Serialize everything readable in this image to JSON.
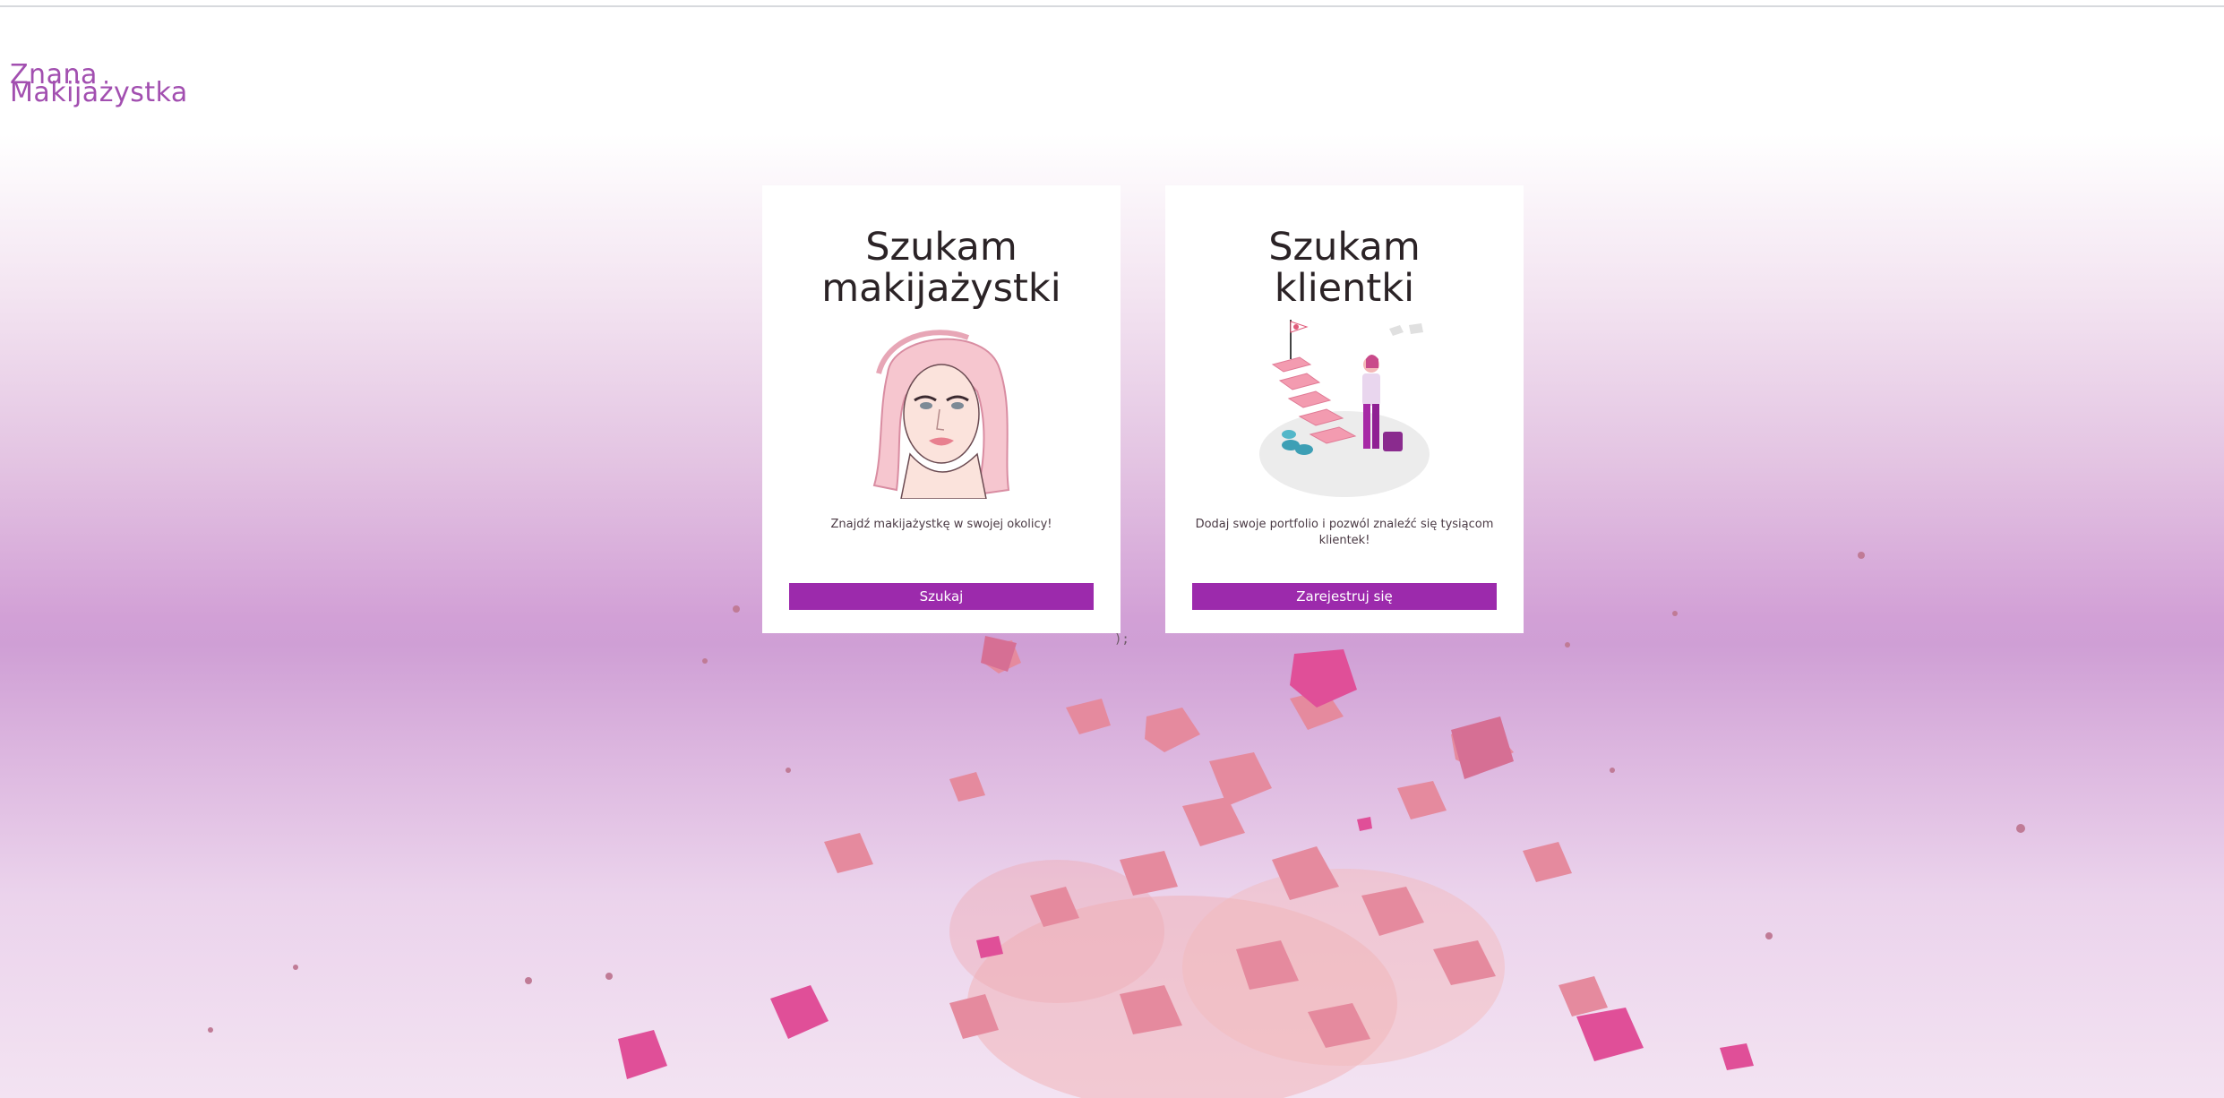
{
  "site": {
    "logo_line1": "Znana",
    "logo_line2": "Makijażystka"
  },
  "cards": [
    {
      "title_line1": "Szukam",
      "title_line2": "makijażystki",
      "description": "Znajdź makijażystkę w swojej okolicy!",
      "button_label": "Szukaj",
      "illustration": "woman-face-illustration"
    },
    {
      "title_line1": "Szukam",
      "title_line2": "klientki",
      "description": "Dodaj swoje portfolio i pozwól znaleźć się tysiącom klientek!",
      "button_label": "Zarejestruj się",
      "illustration": "career-stairs-illustration"
    }
  ],
  "stray_mark": ");",
  "colors": {
    "accent": "#9c2aac",
    "logo": "#a24fb0",
    "title": "#2b2326",
    "background_band": "#cf9fd5"
  }
}
